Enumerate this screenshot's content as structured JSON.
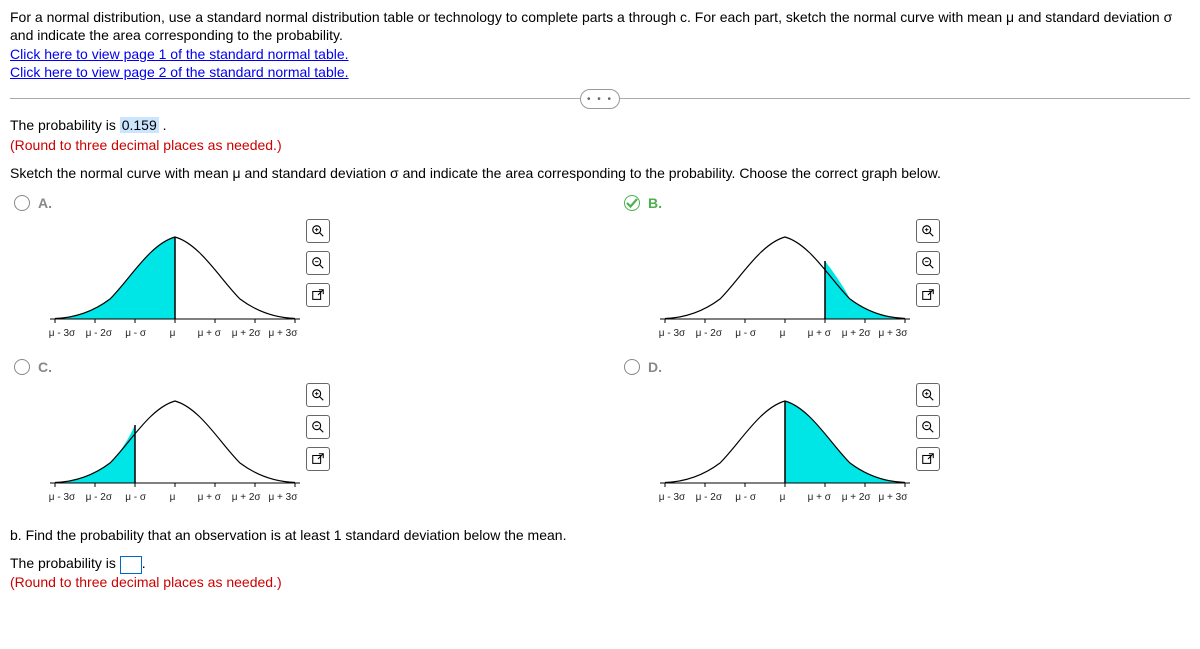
{
  "intro": "For a normal distribution, use a standard normal distribution table or technology to complete parts a through c. For each part, sketch the normal curve with mean μ and standard deviation σ and indicate the area corresponding to the probability.",
  "link1": "Click here to view page 1 of the standard normal table.",
  "link2": "Click here to view page 2 of the standard normal table.",
  "prob_prefix": "The probability is ",
  "prob_value": "0.159",
  "prob_suffix": " .",
  "round_hint": "(Round to three decimal places as needed.)",
  "sketch_instruction": "Sketch the normal curve with mean μ and standard deviation σ and indicate the area corresponding to the probability. Choose the correct graph below.",
  "choices": {
    "A": {
      "label": "A.",
      "selected": false
    },
    "B": {
      "label": "B.",
      "selected": true
    },
    "C": {
      "label": "C.",
      "selected": false
    },
    "D": {
      "label": "D.",
      "selected": false
    }
  },
  "ticks": [
    "μ - 3σ",
    "μ - 2σ",
    "μ - σ",
    "μ",
    "μ + σ",
    "μ + 2σ",
    "μ + 3σ"
  ],
  "partB": {
    "question": "b. Find the probability that an observation is at least 1 standard deviation below the mean.",
    "answer_prefix": "The probability is ",
    "answer_suffix": ".",
    "round_hint": "(Round to three decimal places as needed.)"
  },
  "expand_dots": "• • •",
  "chart_data": [
    {
      "id": "A",
      "type": "normal-curve",
      "xlabels": [
        "μ-3σ",
        "μ-2σ",
        "μ-σ",
        "μ",
        "μ+σ",
        "μ+2σ",
        "μ+3σ"
      ],
      "shaded_region": [
        -3,
        0
      ],
      "shade_color": "#00e5e5"
    },
    {
      "id": "B",
      "type": "normal-curve",
      "xlabels": [
        "μ-3σ",
        "μ-2σ",
        "μ-σ",
        "μ",
        "μ+σ",
        "μ+2σ",
        "μ+3σ"
      ],
      "shaded_region": [
        1,
        3
      ],
      "shade_color": "#00e5e5"
    },
    {
      "id": "C",
      "type": "normal-curve",
      "xlabels": [
        "μ-3σ",
        "μ-2σ",
        "μ-σ",
        "μ",
        "μ+σ",
        "μ+2σ",
        "μ+3σ"
      ],
      "shaded_region": [
        -3,
        -1
      ],
      "shade_color": "#00e5e5"
    },
    {
      "id": "D",
      "type": "normal-curve",
      "xlabels": [
        "μ-3σ",
        "μ-2σ",
        "μ-σ",
        "μ",
        "μ+σ",
        "μ+2σ",
        "μ+3σ"
      ],
      "shaded_region": [
        0,
        3
      ],
      "shade_color": "#00e5e5"
    }
  ]
}
